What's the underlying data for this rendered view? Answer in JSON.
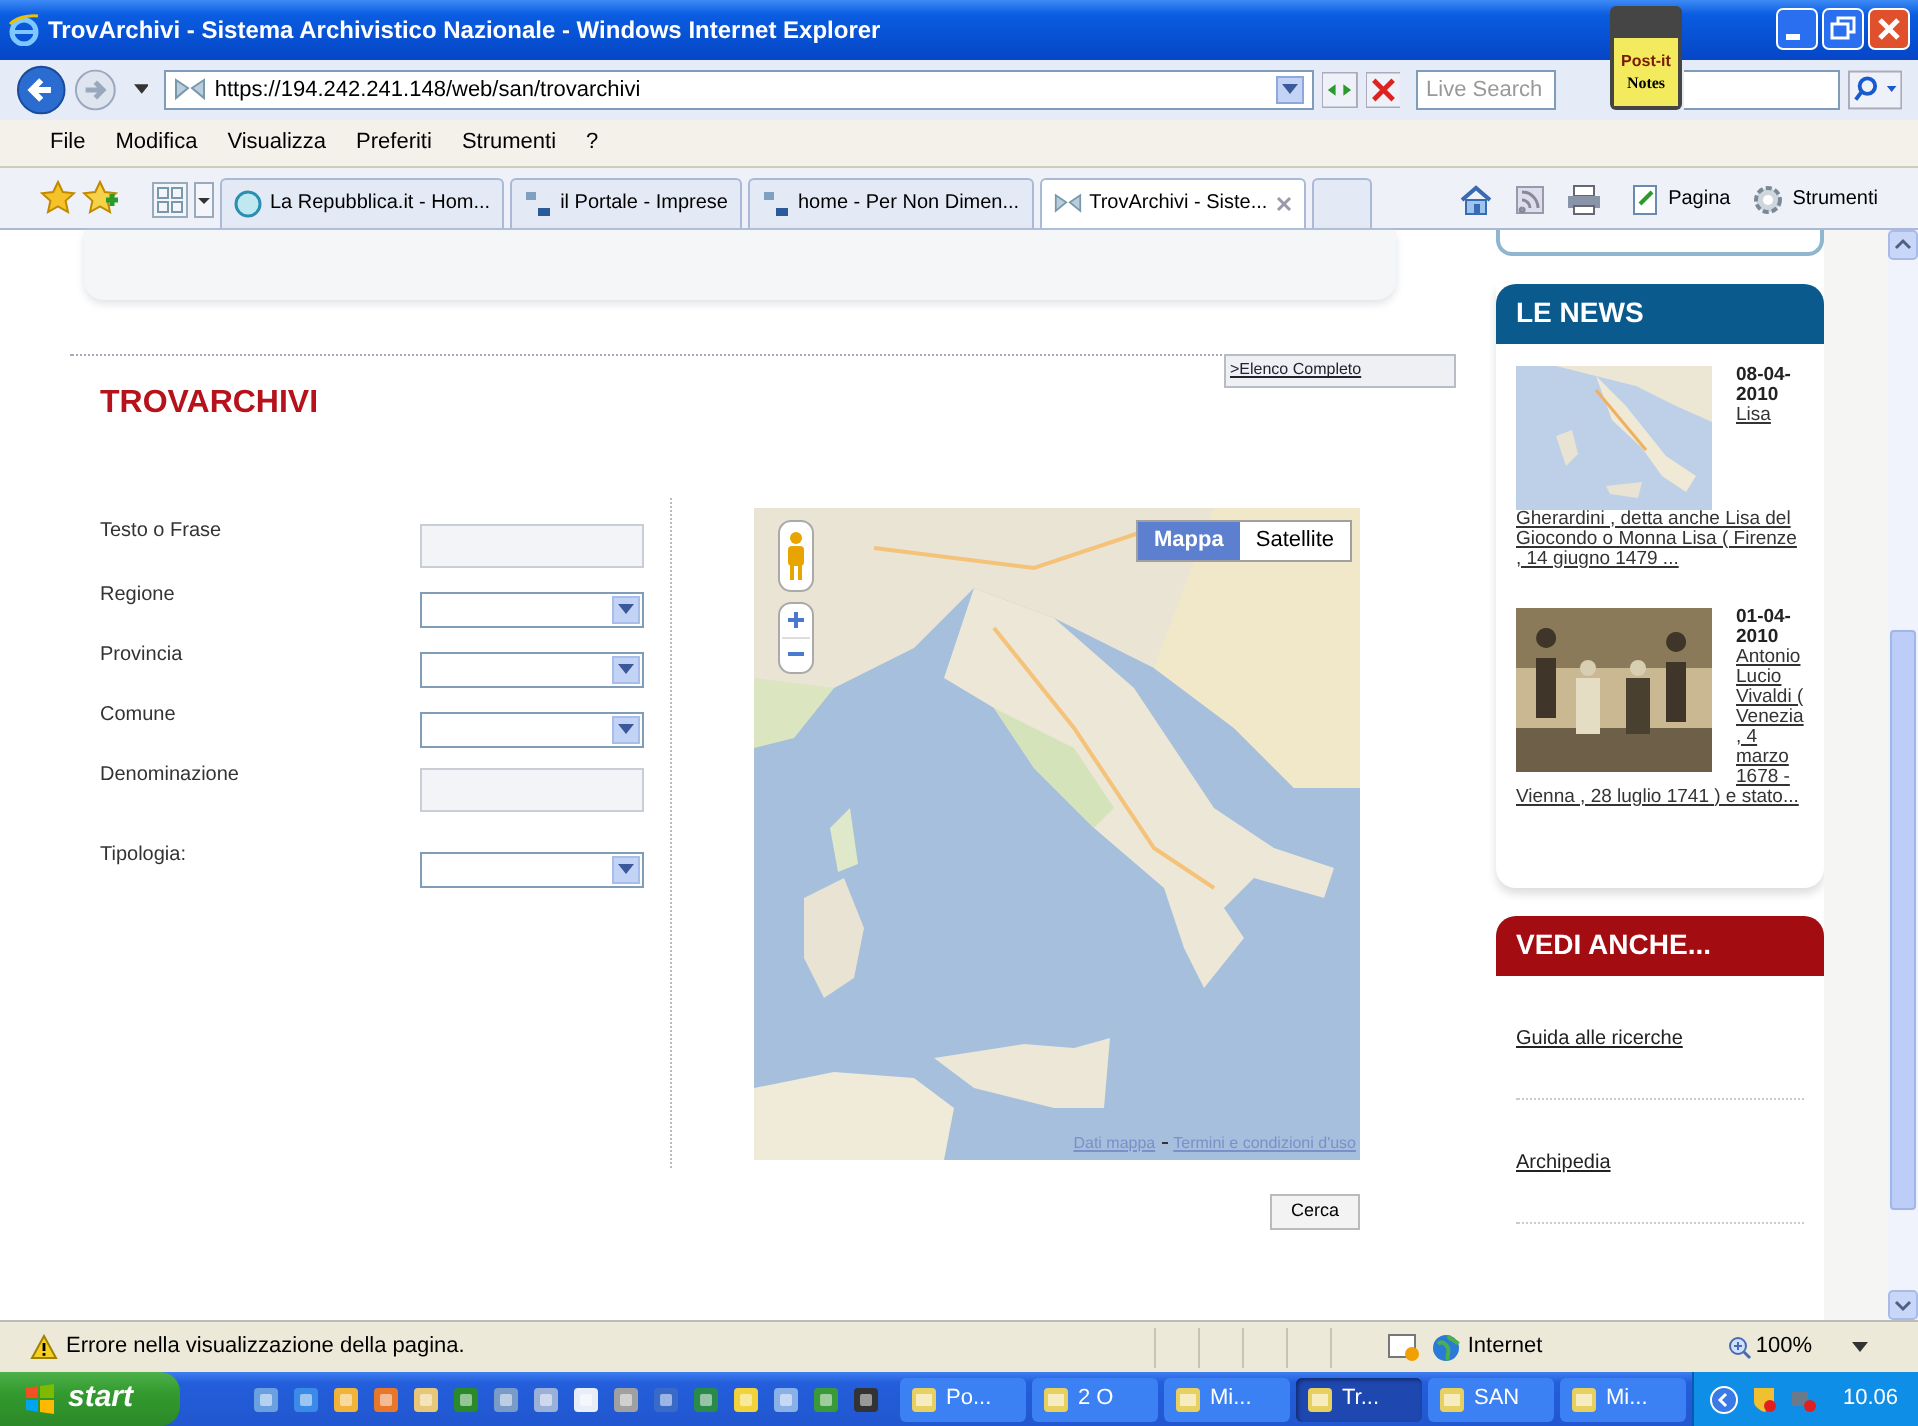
{
  "window": {
    "title": "TrovArchivi - Sistema Archivistico Nazionale - Windows Internet Explorer"
  },
  "address_bar": {
    "url": "https://194.242.241.148/web/san/trovarchivi"
  },
  "search": {
    "placeholder": "Live Search"
  },
  "postit": {
    "line_1": "Post-it",
    "line_2": "Notes"
  },
  "menu": [
    "File",
    "Modifica",
    "Visualizza",
    "Preferiti",
    "Strumenti",
    "?"
  ],
  "tabs": [
    {
      "label": "La Repubblica.it - Hom...",
      "selected": false
    },
    {
      "label": "il Portale - Imprese",
      "selected": false
    },
    {
      "label": "home - Per Non Dimen...",
      "selected": false
    },
    {
      "label": "TrovArchivi - Siste...",
      "selected": true
    }
  ],
  "command_bar": [
    "Pagina",
    "Strumenti"
  ],
  "page": {
    "title": "TROVARCHIVI",
    "list_link": ">Elenco Completo",
    "fields": [
      {
        "label": "Testo o Frase",
        "kind": "text"
      },
      {
        "label": "Regione",
        "kind": "select"
      },
      {
        "label": "Provincia",
        "kind": "select"
      },
      {
        "label": "Comune",
        "kind": "select"
      },
      {
        "label": "Denominazione",
        "kind": "text"
      },
      {
        "label": "Tipologia:",
        "kind": "select"
      }
    ],
    "map": {
      "buttons": [
        {
          "label": "Mappa",
          "selected": true
        },
        {
          "label": "Satellite",
          "selected": false
        }
      ],
      "footer": [
        "Dati mappa",
        "Termini e condizioni d'uso"
      ]
    },
    "submit": "Cerca"
  },
  "news": {
    "title": "LE NEWS",
    "items": [
      {
        "date": "08-04-2010",
        "text": "Lisa Gherardini , detta anche Lisa del Giocondo o Monna Lisa ( Firenze , 14 giugno 1479 ..."
      },
      {
        "date": "01-04-2010",
        "text": "Antonio Lucio Vivaldi ( Venezia , 4 marzo 1678 - Vienna , 28 luglio 1741 ) e stato..."
      }
    ]
  },
  "see_also": {
    "title": "VEDI ANCHE...",
    "links": [
      "Guida alle ricerche",
      "Archipedia"
    ]
  },
  "status_bar": {
    "message": "Errore nella visualizzazione della pagina.",
    "zone": "Internet",
    "zoom": "100%"
  },
  "taskbar": {
    "start": "start",
    "tasks": [
      {
        "label": "Po...",
        "selected": false
      },
      {
        "label": "2 O",
        "selected": false
      },
      {
        "label": "Mi...",
        "selected": false
      },
      {
        "label": "Tr...",
        "selected": true
      },
      {
        "label": "SAN",
        "selected": false
      },
      {
        "label": "Mi...",
        "selected": false
      }
    ],
    "clock": "10.06"
  }
}
